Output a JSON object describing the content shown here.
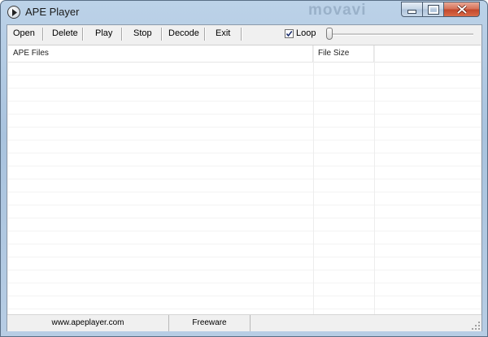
{
  "window": {
    "title": "APE Player",
    "watermark": "movavi"
  },
  "toolbar": {
    "open_label": "Open",
    "delete_label": "Delete",
    "play_label": "Play",
    "stop_label": "Stop",
    "decode_label": "Decode",
    "exit_label": "Exit",
    "loop_label": "Loop",
    "loop_checked": true,
    "volume_level": 0
  },
  "file_list": {
    "columns": [
      "APE Files",
      "File Size"
    ],
    "rows": []
  },
  "status": {
    "website": "www.apeplayer.com",
    "license": "Freeware"
  }
}
